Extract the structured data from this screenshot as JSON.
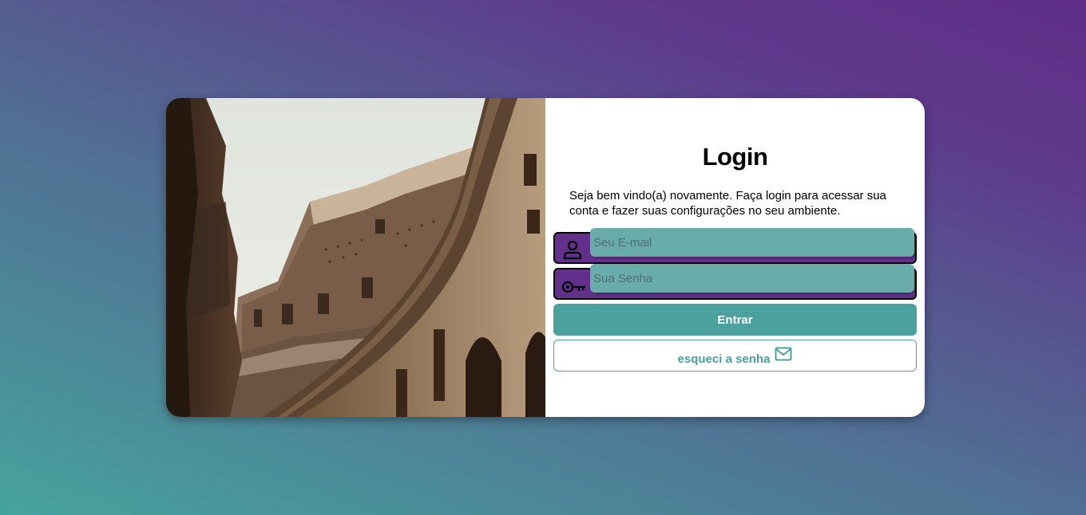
{
  "login": {
    "title": "Login",
    "description": "Seja bem vindo(a) novamente. Faça login para acessar sua conta e fazer suas configurações no seu ambiente.",
    "email": {
      "placeholder": "Seu E-mail",
      "value": "",
      "icon": "user-icon"
    },
    "password": {
      "placeholder": "Sua Senha",
      "value": "",
      "icon": "key-icon"
    },
    "submit_label": "Entrar",
    "forgot": {
      "label": "esqueci a senha",
      "icon": "mail-icon"
    }
  },
  "colors": {
    "accent": "#4aa19d",
    "field_accent": "#62308b",
    "input_bg": "#68ada9"
  }
}
